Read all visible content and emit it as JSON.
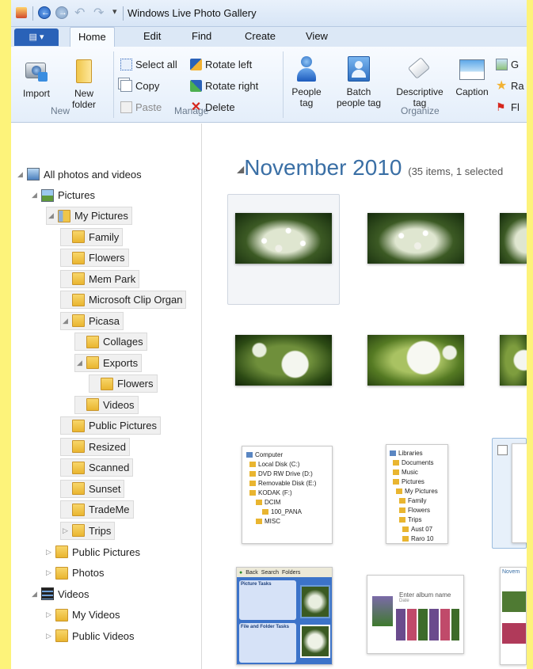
{
  "window": {
    "title": "Windows Live Photo Gallery"
  },
  "ribbon": {
    "tabs": [
      {
        "label": "Home",
        "active": true
      },
      {
        "label": "Edit"
      },
      {
        "label": "Find"
      },
      {
        "label": "Create"
      },
      {
        "label": "View"
      }
    ],
    "groups": {
      "new": {
        "label": "New",
        "import": "Import",
        "new_folder": "New folder"
      },
      "manage": {
        "label": "Manage",
        "select_all": "Select all",
        "copy": "Copy",
        "paste": "Paste",
        "rotate_left": "Rotate left",
        "rotate_right": "Rotate right",
        "delete": "Delete"
      },
      "organize": {
        "label": "Organize",
        "people_tag": "People tag",
        "batch_people_tag": "Batch people tag",
        "descriptive_tag": "Descriptive tag",
        "caption": "Caption",
        "geotag": "G",
        "rate": "Ra",
        "flag": "Fl"
      }
    }
  },
  "nav": {
    "items": [
      {
        "label": "All photos and videos",
        "level": 0,
        "expanded": true,
        "icon": "gallery-icon"
      },
      {
        "label": "Pictures",
        "level": 1,
        "expanded": true,
        "icon": "pictures-icon"
      },
      {
        "label": "My Pictures",
        "level": 2,
        "expanded": true,
        "icon": "library-folder-icon"
      },
      {
        "label": "Family",
        "level": 3
      },
      {
        "label": "Flowers",
        "level": 3
      },
      {
        "label": "Mem Park",
        "level": 3
      },
      {
        "label": "Microsoft Clip Organ",
        "level": 3
      },
      {
        "label": "Picasa",
        "level": 3,
        "expanded": true
      },
      {
        "label": "Collages",
        "level": 4
      },
      {
        "label": "Exports",
        "level": 4,
        "expanded": true
      },
      {
        "label": "Flowers",
        "level": 5
      },
      {
        "label": "Videos",
        "level": 4
      },
      {
        "label": "Public Pictures",
        "level": 3
      },
      {
        "label": "Resized",
        "level": 3
      },
      {
        "label": "Scanned",
        "level": 3
      },
      {
        "label": "Sunset",
        "level": 3
      },
      {
        "label": "TradeMe",
        "level": 3
      },
      {
        "label": "Trips",
        "level": 3,
        "collapsed": true
      },
      {
        "label": "Public Pictures",
        "level": 2,
        "collapsed": true
      },
      {
        "label": "Photos",
        "level": 2,
        "collapsed": true
      },
      {
        "label": "Videos",
        "level": 1,
        "expanded": true,
        "icon": "videos-icon"
      },
      {
        "label": "My Videos",
        "level": 2,
        "collapsed": true
      },
      {
        "label": "Public Videos",
        "level": 2,
        "collapsed": true
      }
    ]
  },
  "content": {
    "group_title": "November 2010",
    "group_count": "(35 items, 1 selected",
    "explorer1": [
      "Computer",
      "Local Disk (C:)",
      "DVD RW Drive (D:)",
      "Removable Disk (E:)",
      "KODAK (F:)",
      "DCIM",
      "100_PANA",
      "MISC"
    ],
    "explorer2": [
      "Libraries",
      "Documents",
      "Music",
      "Pictures",
      "My Pictures",
      "Family",
      "Flowers",
      "Trips",
      "Aust 07",
      "Raro 10"
    ],
    "explorer3": {
      "back": "Back",
      "search": "Search",
      "folders": "Folders",
      "picture_tasks": "Picture Tasks",
      "file_tasks": "File and Folder Tasks"
    },
    "explorer4": {
      "album_name": "Enter album name",
      "date": "Date"
    },
    "explorer5": {
      "heading": "Novem"
    }
  }
}
